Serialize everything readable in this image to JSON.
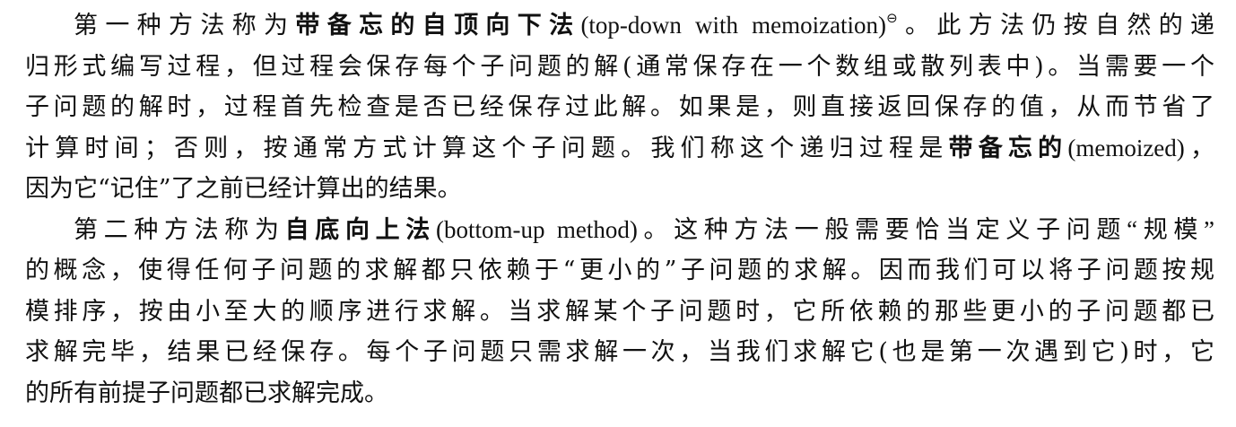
{
  "paragraph1": {
    "l1_a": "第一种方法称为",
    "l1_b": "带备忘的自顶向下法",
    "l1_c": "(top-down with memoization)",
    "l1_mark": "⊖",
    "l1_d": "。此方法仍按自然的递",
    "l2": "归形式编写过程，但过程会保存每个子问题的解(通常保存在一个数组或散列表中)。当需要一个",
    "l3": "子问题的解时，过程首先检查是否已经保存过此解。如果是，则直接返回保存的值，从而节省了",
    "l4_a": "计算时间；否则，按通常方式计算这个子问题。我们称这个递归过程是",
    "l4_b": "带备忘的",
    "l4_c": "(memoized)，",
    "l5": "因为它“记住”了之前已经计算出的结果。"
  },
  "paragraph2": {
    "l1_a": "第二种方法称为",
    "l1_b": "自底向上法",
    "l1_c": "(bottom-up method)。这种方法一般需要恰当定义子问题“规模”",
    "l2": "的概念，使得任何子问题的求解都只依赖于“更小的”子问题的求解。因而我们可以将子问题按规",
    "l3": "模排序，按由小至大的顺序进行求解。当求解某个子问题时，它所依赖的那些更小的子问题都已",
    "l4": "求解完毕，结果已经保存。每个子问题只需求解一次，当我们求解它(也是第一次遇到它)时，它",
    "l5": "的所有前提子问题都已求解完成。"
  }
}
